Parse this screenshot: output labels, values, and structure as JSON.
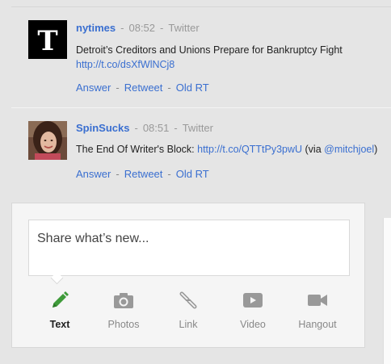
{
  "posts": [
    {
      "author": "nytimes",
      "time": "08:52",
      "source": "Twitter",
      "text": "Detroit’s Creditors and Unions Prepare for Bankruptcy Fight",
      "link": "http://t.co/dsXfWlNCj8",
      "actions": [
        "Answer",
        "Retweet",
        "Old RT"
      ]
    },
    {
      "author": "SpinSucks",
      "time": "08:51",
      "source": "Twitter",
      "text_before": "The End Of Writer's Block: ",
      "link": "http://t.co/QTTtPy3pwU",
      "text_mid": " (via ",
      "mention": "@mitchjoel",
      "text_after": ")",
      "actions": [
        "Answer",
        "Retweet",
        "Old RT"
      ]
    }
  ],
  "share": {
    "placeholder": "Share what’s new...",
    "tools": [
      {
        "label": "Text",
        "icon": "pencil-icon",
        "active": true
      },
      {
        "label": "Photos",
        "icon": "camera-icon",
        "active": false
      },
      {
        "label": "Link",
        "icon": "link-icon",
        "active": false
      },
      {
        "label": "Video",
        "icon": "video-play-icon",
        "active": false
      },
      {
        "label": "Hangout",
        "icon": "video-camera-icon",
        "active": false
      }
    ]
  },
  "colors": {
    "link": "#3a6fd0",
    "active_tool": "#3f9b3a",
    "inactive_tool": "#999999"
  }
}
